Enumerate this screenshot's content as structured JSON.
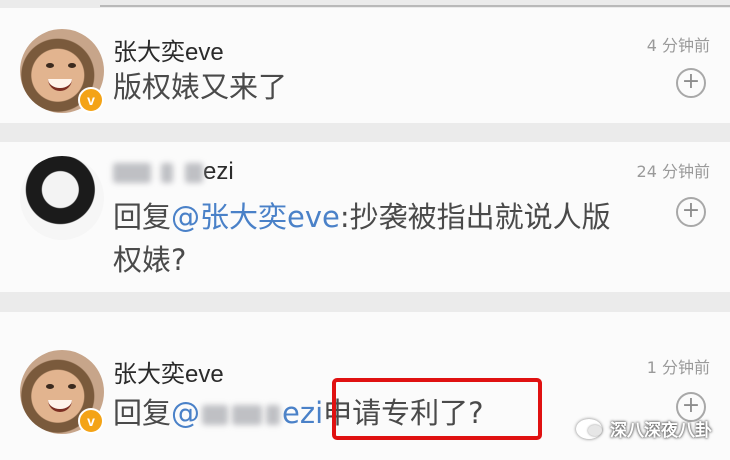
{
  "comments": [
    {
      "username": "张大奕eve",
      "verified_badge": "v",
      "time": "4 分钟前",
      "text": "版权婊又来了",
      "reply_icon": "add-comment-icon"
    },
    {
      "username_visible": "ezi",
      "time": "24 分钟前",
      "reply_prefix": "回复",
      "mention": "@张大奕eve",
      "text_line1": ":抄袭被指出就说人版",
      "text_line2": "权婊?",
      "reply_icon": "add-comment-icon"
    },
    {
      "username": "张大奕eve",
      "verified_badge": "v",
      "time": "1 分钟前",
      "reply_prefix": "回复",
      "mention_start": "@",
      "mention_end": "ezi",
      "highlighted_text": "申请专利了?",
      "reply_icon": "add-comment-icon"
    }
  ],
  "watermark": {
    "text": "深八深夜八卦",
    "icon": "wechat-icon"
  },
  "colors": {
    "mention": "#4a81c8",
    "highlight_box": "#e01111",
    "verified_badge": "#f4a316"
  }
}
